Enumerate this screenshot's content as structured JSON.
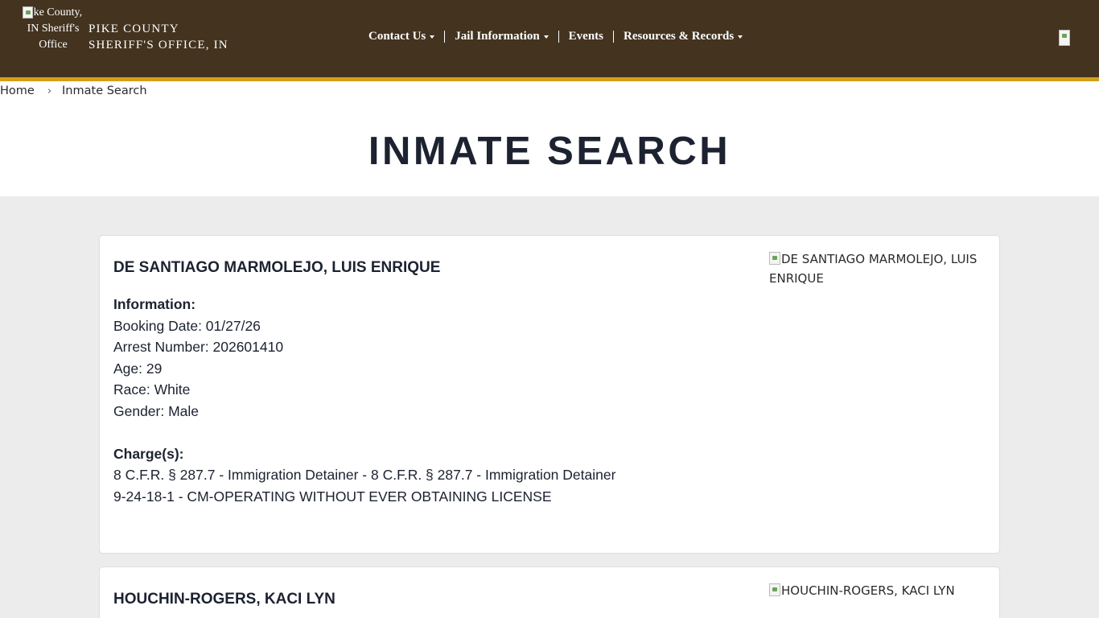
{
  "header": {
    "logo_alt": "Pike County, IN Sheriff's Office",
    "org_name_line1": "PIKE COUNTY",
    "org_name_line2": "SHERIFF'S OFFICE, IN",
    "nav": [
      {
        "label": "Contact Us",
        "has_dropdown": true
      },
      {
        "label": "Jail Information",
        "has_dropdown": true
      },
      {
        "label": "Events",
        "has_dropdown": false
      },
      {
        "label": "Resources & Records",
        "has_dropdown": true
      }
    ],
    "search_icon": "search-icon",
    "colors": {
      "bar": "#43331f",
      "stripe": "#d4a019"
    }
  },
  "breadcrumb": {
    "items": [
      "Home",
      "Inmate Search"
    ],
    "separator": "›"
  },
  "page_title": "INMATE SEARCH",
  "inmates": [
    {
      "name": "DE SANTIAGO MARMOLEJO, LUIS ENRIQUE",
      "photo_alt": "DE SANTIAGO MARMOLEJO, LUIS ENRIQUE",
      "info_heading": "Information:",
      "booking_date": "Booking Date: 01/27/26",
      "arrest_number": "Arrest Number: 202601410",
      "age": "Age: 29",
      "race": "Race: White",
      "gender": "Gender: Male",
      "charges_heading": "Charge(s):",
      "charges": [
        "8 C.F.R. § 287.7 - Immigration Detainer - 8 C.F.R. § 287.7 - Immigration Detainer",
        "9-24-18-1 - CM-OPERATING WITHOUT EVER OBTAINING LICENSE"
      ]
    },
    {
      "name": "HOUCHIN-ROGERS, KACI LYN",
      "photo_alt": "HOUCHIN-ROGERS, KACI LYN"
    }
  ]
}
